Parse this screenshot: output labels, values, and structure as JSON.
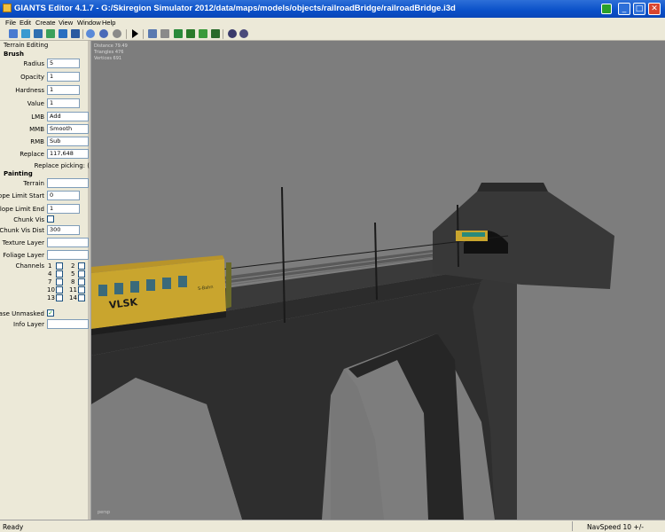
{
  "window": {
    "title": "GIANTS Editor 4.1.7 - G:/Skiregion Simulator 2012/data/maps/models/objects/railroadBridge/railroadBridge.i3d",
    "minimize": "_",
    "maximize": "□",
    "close": "✕"
  },
  "menu": [
    "File",
    "Edit",
    "Create",
    "View",
    "Window",
    "Help"
  ],
  "toolbar_icons": [
    "new-file-icon",
    "open-file-icon",
    "save-icon",
    "save-as-icon",
    "export-icon",
    "import-icon",
    "undo-icon",
    "redo-icon",
    "redo-alt-icon",
    "play-icon",
    "home-icon",
    "magnet-icon",
    "terrain-raise-icon",
    "terrain-paint-icon",
    "foliage-icon",
    "tree-icon",
    "gear-icon",
    "settings-icon"
  ],
  "panel": {
    "title": "Terrain Editing",
    "brush": {
      "heading": "Brush",
      "radius_label": "Radius",
      "radius_value": "5",
      "opacity_label": "Opacity",
      "opacity_value": "1",
      "hardness_label": "Hardness",
      "hardness_value": "1",
      "value_label": "Value",
      "value_value": "1",
      "lmb_label": "LMB",
      "lmb_value": "Add",
      "mmb_label": "MMB",
      "mmb_value": "Smooth",
      "rmb_label": "RMB",
      "rmb_value": "Sub",
      "replace_label": "Replace",
      "replace_value": "117,648",
      "replace_picking_label": "Replace picking: ("
    },
    "painting": {
      "heading": "Painting",
      "terrain_label": "Terrain",
      "terrain_value": "",
      "slope_start_label": "Slope Limit Start",
      "slope_start_value": "0",
      "slope_end_label": "Slope Limit End",
      "slope_end_value": "1",
      "chunk_vis_label": "Chunk Vis",
      "chunk_vis_dist_label": "Chunk Vis Dist",
      "chunk_vis_dist_value": "300",
      "texture_layer_label": "Texture Layer",
      "texture_layer_value": "",
      "foliage_layer_label": "Foliage Layer",
      "foliage_layer_value": "",
      "channels_label": "Channels",
      "channels": [
        "1",
        "2",
        "4",
        "5",
        "7",
        "8",
        "10",
        "11",
        "13",
        "14"
      ],
      "erase_unmasked_label": "Erase Unmasked",
      "erase_unmasked_checked": "✓",
      "info_layer_label": "Info Layer",
      "info_layer_value": ""
    }
  },
  "viewport": {
    "stats": [
      "Distance 79.49",
      "Triangles 476",
      "Vertices 691"
    ],
    "corner_label": "persp",
    "train_label": "VLSK",
    "train_small_label": "S-Bahn",
    "colors": {
      "background": "#7d7d7d",
      "stone": "#2e2e2e",
      "train": "#c9a52e"
    }
  },
  "status": {
    "text": "Ready",
    "navspeed": "NavSpeed 10 +/-"
  }
}
